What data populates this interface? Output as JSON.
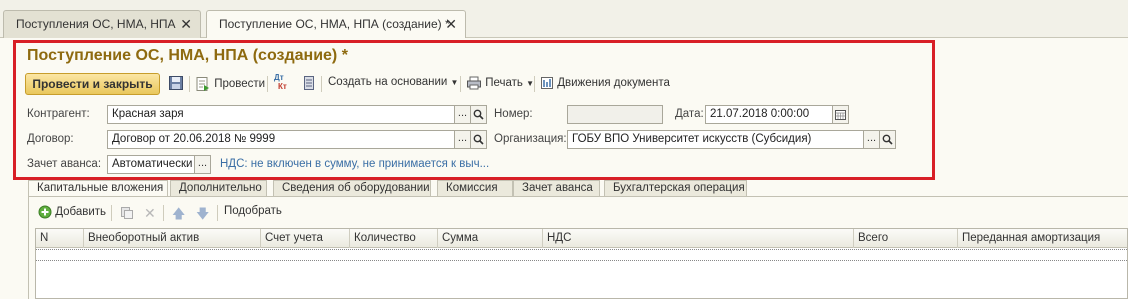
{
  "window_tabs": [
    {
      "label": "Поступления ОС, НМА, НПА",
      "active": false
    },
    {
      "label": "Поступление ОС, НМА, НПА (создание) *",
      "active": true
    }
  ],
  "form": {
    "title": "Поступление ОС, НМА, НПА (создание) *"
  },
  "toolbar": {
    "post_and_close": "Провести и закрыть",
    "post": "Провести",
    "dt_kt_top": "Дт",
    "dt_kt_bottom": "Кт",
    "create_based_on": "Создать на основании",
    "print": "Печать",
    "document_movements": "Движения документа"
  },
  "fields": {
    "counterparty_label": "Контрагент:",
    "counterparty_value": "Красная заря",
    "number_label": "Номер:",
    "number_value": "",
    "date_label": "Дата:",
    "date_value": "21.07.2018  0:00:00",
    "contract_label": "Договор:",
    "contract_value": "Договор от 20.06.2018 № 9999",
    "organization_label": "Организация:",
    "organization_value": "ГОБУ ВПО Университет искусств (Субсидия)",
    "advance_label": "Зачет аванса:",
    "advance_value": "Автоматически",
    "vat_link": "НДС: не включен в сумму, не принимается к выч..."
  },
  "inner_tabs": [
    "Капитальные вложения",
    "Дополнительно",
    "Сведения об оборудовании",
    "Комиссия",
    "Зачет аванса",
    "Бухгалтерская операция"
  ],
  "table_toolbar": {
    "add": "Добавить",
    "select": "Подобрать"
  },
  "table": {
    "columns": [
      "N",
      "Внеоборотный актив",
      "Счет учета",
      "Количество",
      "Сумма",
      "НДС",
      "Всего",
      "Переданная амортизация"
    ],
    "rows": []
  },
  "colors": {
    "title": "#8e6a0f",
    "highlight_border": "#d81f26",
    "primary_button": "#e9c75c",
    "link": "#3a6ea5"
  }
}
